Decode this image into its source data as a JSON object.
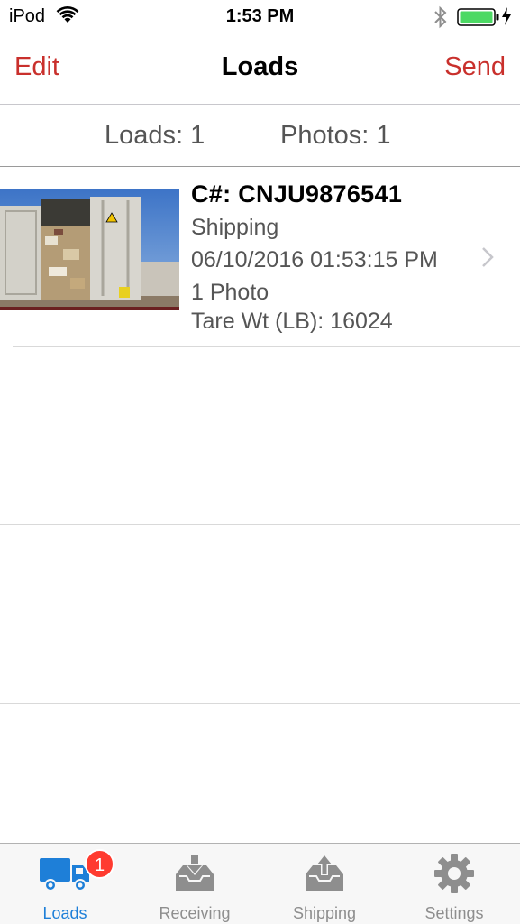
{
  "status_bar": {
    "carrier": "iPod",
    "time": "1:53 PM",
    "battery_color": "#4cd964"
  },
  "nav": {
    "left_label": "Edit",
    "title": "Loads",
    "right_label": "Send",
    "accent_color": "#c9302c"
  },
  "summary": {
    "loads": "Loads: 1",
    "photos": "Photos: 1"
  },
  "loads": [
    {
      "container_number": "C#: CNJU9876541",
      "type": "Shipping",
      "timestamp": "06/10/2016 01:53:15 PM",
      "photo_count": "1 Photo",
      "tare_weight": "Tare Wt (LB): 16024",
      "thumbnail": "container-photo"
    }
  ],
  "tabs": [
    {
      "label": "Loads",
      "icon": "truck-icon",
      "badge": "1",
      "active": true
    },
    {
      "label": "Receiving",
      "icon": "inbox-download-icon",
      "active": false
    },
    {
      "label": "Shipping",
      "icon": "inbox-upload-icon",
      "active": false
    },
    {
      "label": "Settings",
      "icon": "gear-icon",
      "active": false
    }
  ],
  "colors": {
    "tab_active": "#1e7fd8",
    "tab_inactive": "#8e8e8e",
    "badge": "#ff3b30"
  }
}
